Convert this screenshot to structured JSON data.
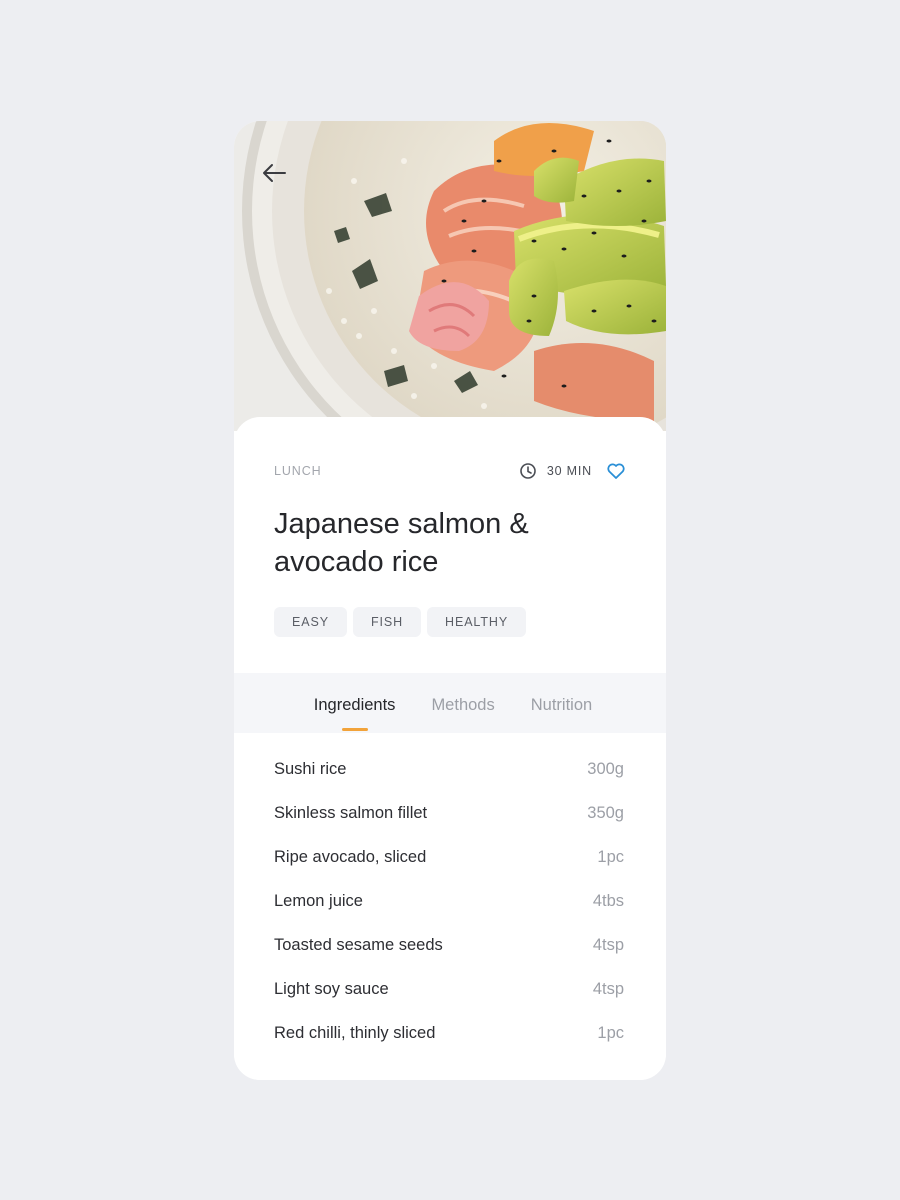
{
  "header": {
    "back_icon": "arrow-left-icon",
    "hero_image": "salmon-avocado-rice-bowl-photo"
  },
  "recipe": {
    "category": "LUNCH",
    "time": "30 MIN",
    "clock_icon": "clock-icon",
    "favorite_icon": "heart-icon",
    "title": "Japanese salmon & avocado rice",
    "tags": [
      "EASY",
      "FISH",
      "HEALTHY"
    ]
  },
  "tabs": {
    "items": [
      "Ingredients",
      "Methods",
      "Nutrition"
    ],
    "active": "Ingredients"
  },
  "ingredients": [
    {
      "name": "Sushi rice",
      "qty": "300g"
    },
    {
      "name": "Skinless salmon fillet",
      "qty": "350g"
    },
    {
      "name": "Ripe avocado, sliced",
      "qty": "1pc"
    },
    {
      "name": "Lemon juice",
      "qty": "4tbs"
    },
    {
      "name": "Toasted sesame seeds",
      "qty": "4tsp"
    },
    {
      "name": "Light soy sauce",
      "qty": "4tsp"
    },
    {
      "name": "Red chilli, thinly sliced",
      "qty": "1pc"
    }
  ],
  "colors": {
    "background": "#edeef2",
    "accent": "#f2a33a",
    "favorite": "#2a8fd6",
    "text": "#26272b",
    "muted": "#9c9fa6"
  }
}
